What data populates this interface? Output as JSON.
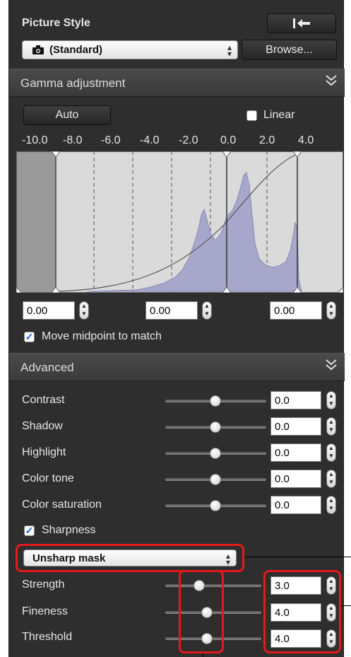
{
  "picture_style": {
    "label": "Picture Style",
    "reset_icon": "revert-arrow-icon",
    "selected": "(Standard)",
    "camera_icon": "camera-icon",
    "browse_label": "Browse..."
  },
  "gamma": {
    "title": "Gamma adjustment",
    "auto_label": "Auto",
    "linear_label": "Linear",
    "ev_ticks": [
      "-10.0",
      "-8.0",
      "-6.0",
      "-4.0",
      "-2.0",
      "0.0",
      "2.0",
      "4.0"
    ],
    "field_left": "0.00",
    "field_mid": "0.00",
    "field_right": "0.00",
    "move_midpoint_label": "Move midpoint to match"
  },
  "advanced": {
    "title": "Advanced",
    "rows": [
      {
        "label": "Contrast",
        "value": "0.0"
      },
      {
        "label": "Shadow",
        "value": "0.0"
      },
      {
        "label": "Highlight",
        "value": "0.0"
      },
      {
        "label": "Color tone",
        "value": "0.0"
      },
      {
        "label": "Color saturation",
        "value": "0.0"
      }
    ],
    "sharpness_label": "Sharpness",
    "sharp_mode": "Unsharp mask",
    "sharp_rows": [
      {
        "label": "Strength",
        "value": "3.0"
      },
      {
        "label": "Fineness",
        "value": "4.0"
      },
      {
        "label": "Threshold",
        "value": "4.0"
      }
    ]
  },
  "colors": {
    "panel": "#2e2e2e",
    "histogram": "#a7a7cc",
    "highlight": "#e21a1a"
  }
}
